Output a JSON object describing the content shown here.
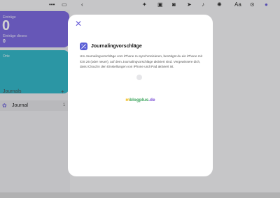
{
  "toolbar": {
    "icons": [
      "more-icon",
      "sidebar-icon",
      "back-icon",
      "magic-icon",
      "photo-icon",
      "camera-icon",
      "location-icon",
      "audio-icon",
      "more-icons-icon",
      "text-format-icon",
      "more-options-icon",
      "avatar"
    ],
    "text_format_label": "Aa"
  },
  "sidebar": {
    "stats_card": {
      "label": "Einträge",
      "value": "0",
      "sub_label": "Einträge dieses",
      "sub_value": "0"
    },
    "places_card": {
      "label": "Orte"
    },
    "journals_header": "Journals",
    "journal": {
      "name": "Journal",
      "count": "1"
    }
  },
  "modal": {
    "title": "Journalingvorschläge",
    "body": "Um Journalingvorschläge vom iPhone zu synchronisieren, benötigst du ein iPhone mit iOS 26 (oder neuer), auf dem Journalingvorschläge aktiviert sind. Vergewissere dich, dass iCloud in den Einstellungen von iPhone und iPad aktiviert ist.",
    "watermark": {
      "part1": "m",
      "part2": "blogplus",
      "part3": ".de"
    }
  },
  "colors": {
    "accent": "#6a5fd8",
    "stats_card": "#7d6be0",
    "places_card": "#35b8c9"
  }
}
